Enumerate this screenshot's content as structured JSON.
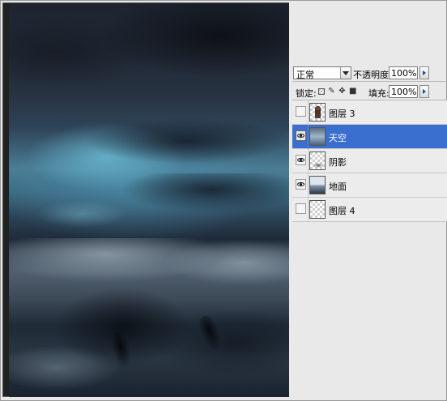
{
  "canvas": {
    "description_icon": "image-canvas"
  },
  "layers_panel": {
    "blend_mode": "正常",
    "opacity_label": "不透明度:",
    "opacity_value": "100%",
    "lock_label": "锁定:",
    "fill_label": "填充:",
    "fill_value": "100%",
    "layers": [
      {
        "name": "图层 3",
        "visible": false,
        "selected": false,
        "thumb": "figure"
      },
      {
        "name": "天空",
        "visible": true,
        "selected": true,
        "thumb": "sky"
      },
      {
        "name": "阴影",
        "visible": true,
        "selected": false,
        "thumb": "shadow"
      },
      {
        "name": "地面",
        "visible": true,
        "selected": false,
        "thumb": "ground"
      },
      {
        "name": "图层 4",
        "visible": false,
        "selected": false,
        "thumb": "transparent"
      }
    ]
  },
  "colors": {
    "selection": "#3a6fd0",
    "panel_bg": "#ececec"
  }
}
